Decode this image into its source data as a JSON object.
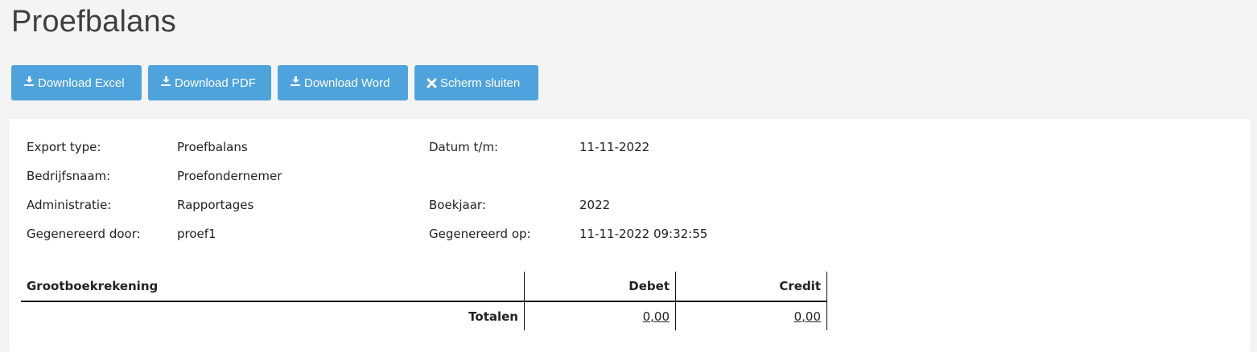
{
  "page": {
    "title": "Proefbalans"
  },
  "toolbar": {
    "download_excel": "Download Excel",
    "download_pdf": "Download PDF",
    "download_word": "Download Word",
    "close_screen": "Scherm sluiten"
  },
  "meta": {
    "export_type_label": "Export type:",
    "export_type_value": "Proefbalans",
    "datum_label": "Datum t/m:",
    "datum_value": "11-11-2022",
    "bedrijfsnaam_label": "Bedrijfsnaam:",
    "bedrijfsnaam_value": "Proefondernemer",
    "administratie_label": "Administratie:",
    "administratie_value": "Rapportages",
    "boekjaar_label": "Boekjaar:",
    "boekjaar_value": "2022",
    "gegenereerd_door_label": "Gegenereerd door:",
    "gegenereerd_door_value": "proef1",
    "gegenereerd_op_label": "Gegenereerd op:",
    "gegenereerd_op_value": "11-11-2022 09:32:55"
  },
  "table": {
    "headers": {
      "account": "Grootboekrekening",
      "debet": "Debet",
      "credit": "Credit"
    },
    "totals": {
      "label": "Totalen",
      "debet": "0,00",
      "credit": "0,00"
    }
  },
  "colors": {
    "button": "#4fa3dc",
    "background": "#f4f4f4",
    "panel": "#ffffff"
  },
  "icons": {
    "download": "download-icon",
    "close": "close-x-icon"
  }
}
